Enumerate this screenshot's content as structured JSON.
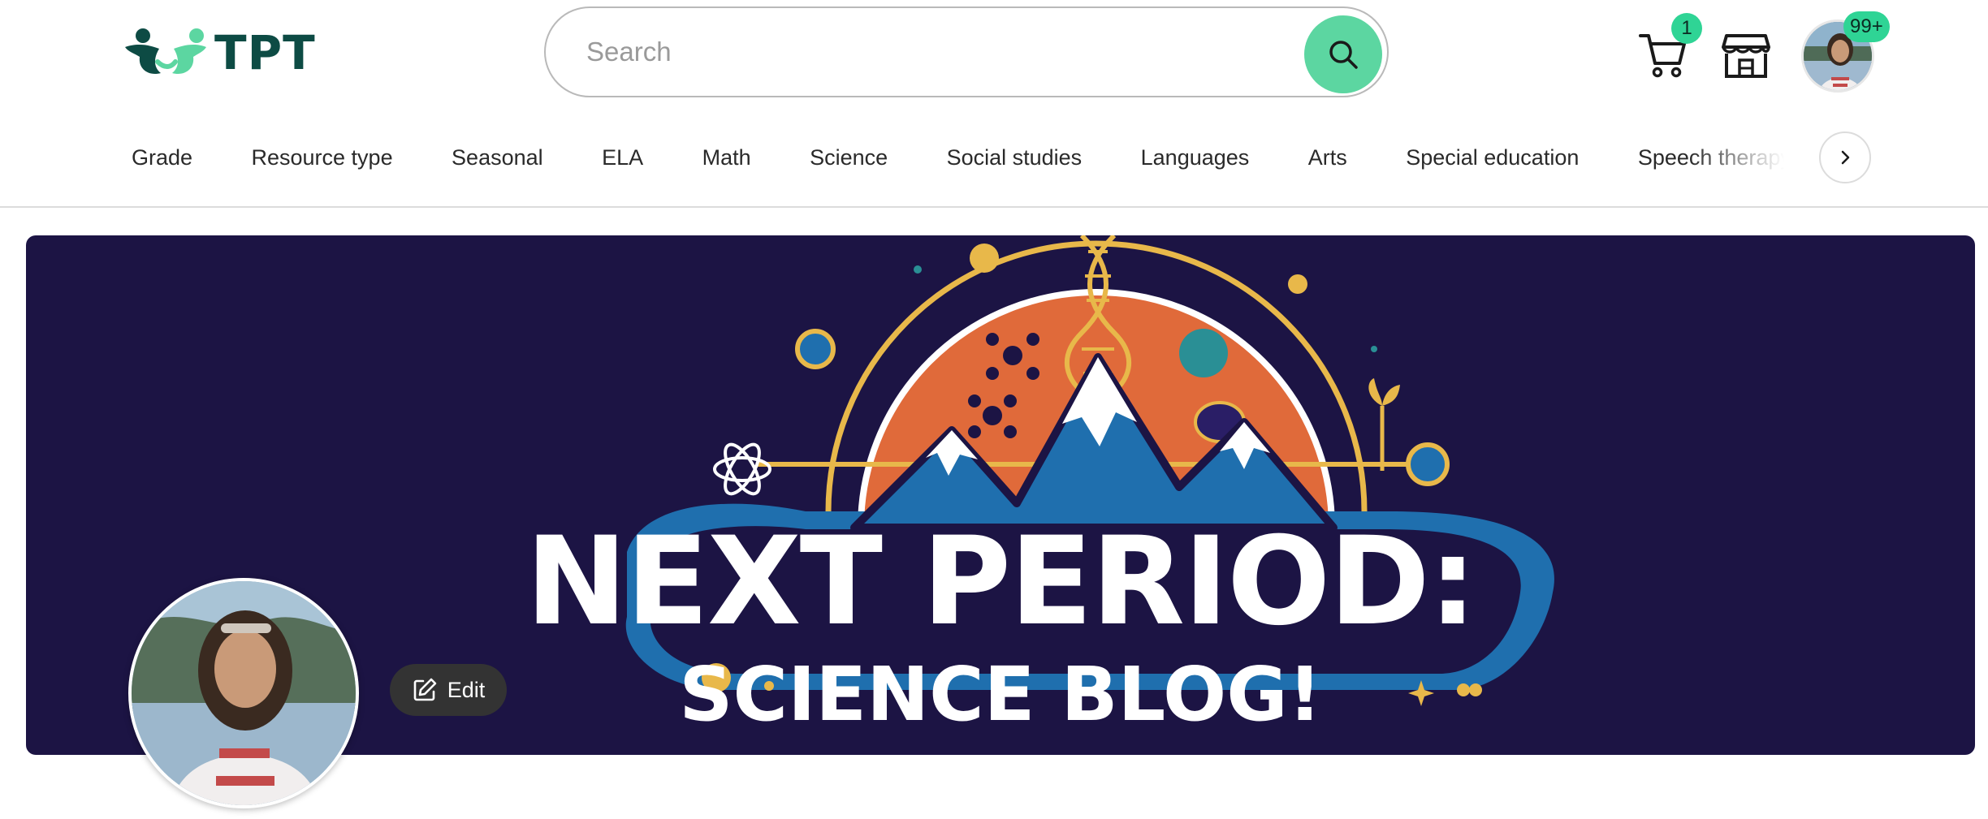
{
  "header": {
    "logo_text": "TPT",
    "search": {
      "placeholder": "Search"
    },
    "cart_count": "1",
    "notification_count": "99+"
  },
  "nav": {
    "items": [
      "Grade",
      "Resource type",
      "Seasonal",
      "ELA",
      "Math",
      "Science",
      "Social studies",
      "Languages",
      "Arts",
      "Special education",
      "Speech therapy"
    ]
  },
  "banner": {
    "title": "NEXT PERIOD:",
    "subtitle": "SCIENCE BLOG!",
    "background_color": "#1c1444"
  },
  "profile": {
    "edit_label": "Edit"
  },
  "colors": {
    "brand_dark": "#0d4b44",
    "brand_accent": "#5cd6a1",
    "badge": "#2fd495"
  },
  "icons": {
    "search": "search-icon",
    "cart": "cart-icon",
    "store": "store-icon",
    "chevron": "chevron-right-icon",
    "edit": "edit-icon"
  }
}
